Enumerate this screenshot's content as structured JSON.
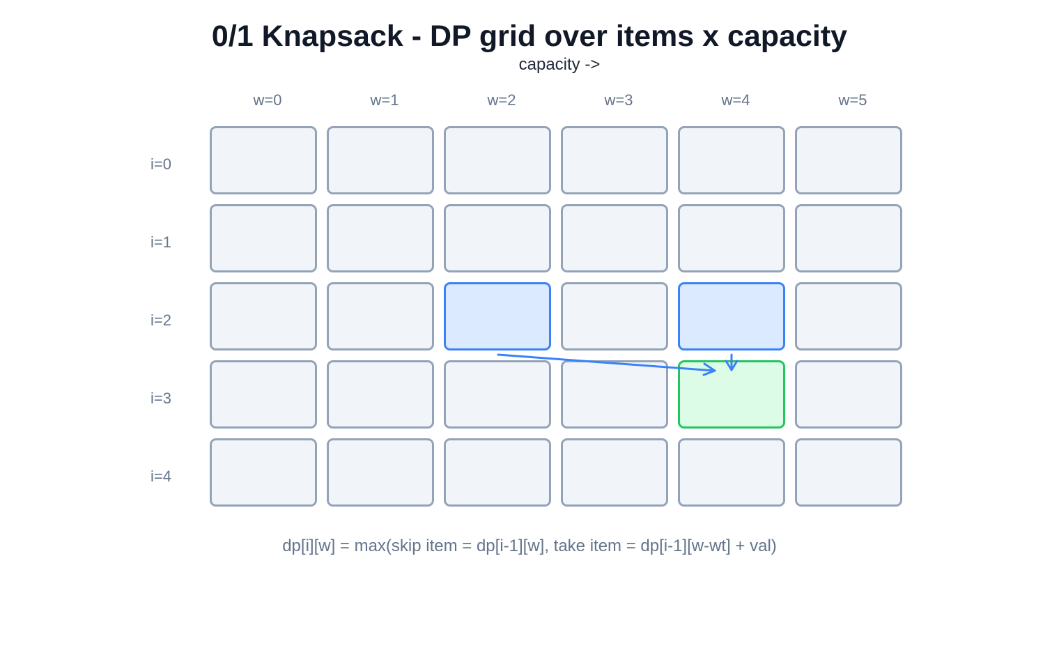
{
  "title": "0/1 Knapsack - DP grid over items x capacity",
  "axis_caption": "capacity ->",
  "columns": [
    "w=0",
    "w=1",
    "w=2",
    "w=3",
    "w=4",
    "w=5"
  ],
  "rows": [
    "i=0",
    "i=1",
    "i=2",
    "i=3",
    "i=4"
  ],
  "highlights": {
    "dependency_cells": [
      {
        "row": 2,
        "col": 2
      },
      {
        "row": 2,
        "col": 4
      }
    ],
    "target_cell": {
      "row": 3,
      "col": 4
    },
    "dependency_color": "#3b82f6",
    "target_color": "#22c55e"
  },
  "formula": "dp[i][w] = max(skip item = dp[i-1][w],  take item = dp[i-1][w-wt] + val)",
  "colors": {
    "cell_border": "#94a3b8",
    "cell_fill": "#f1f5f9",
    "dependency_fill": "#dbeafe",
    "target_fill": "#dcfce7",
    "arrow": "#3b82f6"
  }
}
